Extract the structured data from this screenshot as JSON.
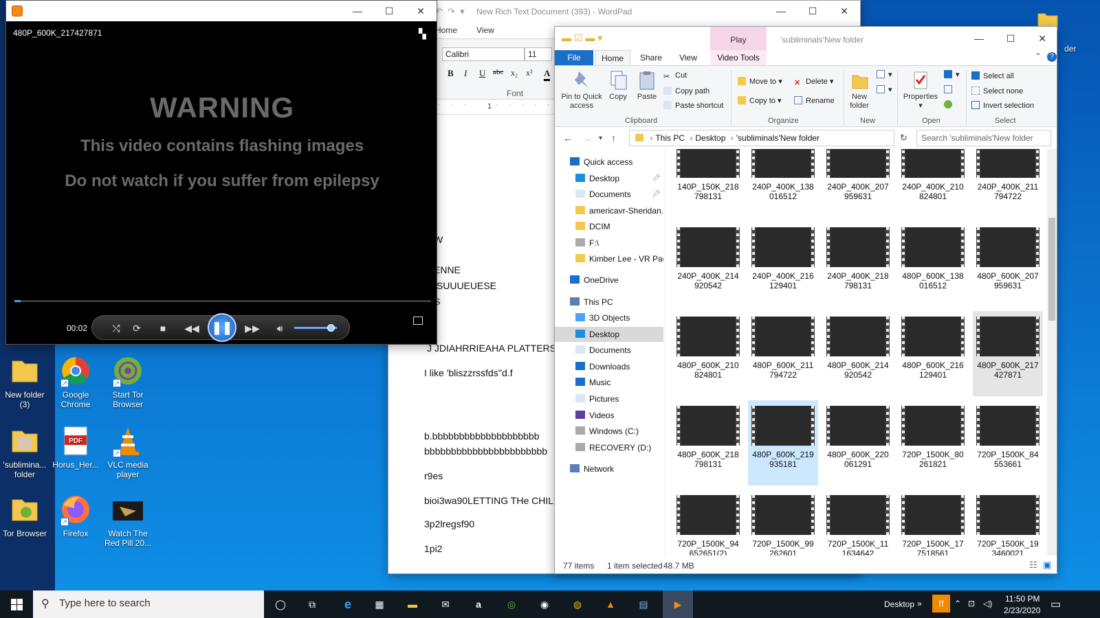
{
  "desktop": {
    "icons": [
      {
        "label": "New folder (3)"
      },
      {
        "label": "Google Chrome"
      },
      {
        "label": "Start Tor Browser"
      },
      {
        "label": "'sublimina... folder"
      },
      {
        "label": "Horus_Her..."
      },
      {
        "label": "VLC media player"
      },
      {
        "label": "Tor Browser"
      },
      {
        "label": "Firefox"
      },
      {
        "label": "Watch The Red Pill 20..."
      }
    ],
    "partial_label": "der"
  },
  "media_player": {
    "video_title": "480P_600K_217427871",
    "warning_heading": "WARNING",
    "warning_line1": "This video contains flashing images",
    "warning_line2": "Do not watch if you suffer from epilepsy",
    "time": "00:02",
    "progress_fraction": 0.015,
    "volume_fraction": 0.85
  },
  "wordpad": {
    "title": "New Rich Text Document (393) - WordPad",
    "tabs": [
      "Home",
      "View"
    ],
    "font_name": "Calibri",
    "font_size": "11",
    "font_group_label": "Font",
    "ruler_mark": "1",
    "doc_lines": [
      "I",
      "W",
      "ENNE",
      "ISUUUEUESE",
      "S",
      "J JDIAHRRIEAHA PLATTERS.",
      "I like 'bliszzrssfds''d.f",
      "b.bbbbbbbbbbbbbbbbbbbb",
      "bbbbbbbbbbbbbbbbbbbbbbb",
      "r9es",
      "bioi3wa90LETTING THe CHIL",
      "3p2lregsf90",
      "1pi2"
    ]
  },
  "explorer": {
    "title": "'subliminals'New folder",
    "contextual_tab": "Play",
    "tabs": {
      "file": "File",
      "home": "Home",
      "share": "Share",
      "view": "View",
      "video_tools": "Video Tools"
    },
    "ribbon": {
      "pin": "Pin to Quick access",
      "copy": "Copy",
      "paste": "Paste",
      "cut": "Cut",
      "copy_path": "Copy path",
      "paste_shortcut": "Paste shortcut",
      "clipboard_label": "Clipboard",
      "move_to": "Move to",
      "copy_to": "Copy to",
      "delete": "Delete",
      "rename": "Rename",
      "organize_label": "Organize",
      "new_folder": "New folder",
      "new_label": "New",
      "properties": "Properties",
      "open_label": "Open",
      "select_all": "Select all",
      "select_none": "Select none",
      "invert_selection": "Invert selection",
      "select_label": "Select"
    },
    "address": [
      "This PC",
      "Desktop",
      "'subliminals'New folder"
    ],
    "search_placeholder": "Search 'subliminals'New folder",
    "nav": [
      {
        "label": "Quick access",
        "level": 0
      },
      {
        "label": "Desktop",
        "level": 1,
        "pinned": true
      },
      {
        "label": "Documents",
        "level": 1,
        "pinned": true
      },
      {
        "label": "americavr-Sheridan.",
        "level": 1
      },
      {
        "label": "DCIM",
        "level": 1
      },
      {
        "label": "F:\\",
        "level": 1
      },
      {
        "label": "Kimber Lee - VR Pac",
        "level": 1
      },
      {
        "label": "OneDrive",
        "level": 0
      },
      {
        "label": "This PC",
        "level": 0
      },
      {
        "label": "3D Objects",
        "level": 1
      },
      {
        "label": "Desktop",
        "level": 1,
        "selected": true
      },
      {
        "label": "Documents",
        "level": 1
      },
      {
        "label": "Downloads",
        "level": 1
      },
      {
        "label": "Music",
        "level": 1
      },
      {
        "label": "Pictures",
        "level": 1
      },
      {
        "label": "Videos",
        "level": 1
      },
      {
        "label": "Windows (C:)",
        "level": 1
      },
      {
        "label": "RECOVERY (D:)",
        "level": 1
      },
      {
        "label": "Network",
        "level": 0
      }
    ],
    "files": [
      {
        "name": "140P_150K_218798131"
      },
      {
        "name": "240P_400K_138016512"
      },
      {
        "name": "240P_400K_207959631"
      },
      {
        "name": "240P_400K_210824801"
      },
      {
        "name": "240P_400K_211794722"
      },
      {
        "name": "240P_400K_214920542"
      },
      {
        "name": "240P_400K_216129401"
      },
      {
        "name": "240P_400K_218798131"
      },
      {
        "name": "480P_600K_138016512"
      },
      {
        "name": "480P_600K_207959631"
      },
      {
        "name": "480P_600K_210824801"
      },
      {
        "name": "480P_600K_211794722"
      },
      {
        "name": "480P_600K_214920542"
      },
      {
        "name": "480P_600K_216129401"
      },
      {
        "name": "480P_600K_217427871",
        "state": "hover"
      },
      {
        "name": "480P_600K_218798131"
      },
      {
        "name": "480P_600K_219935181",
        "state": "selected"
      },
      {
        "name": "480P_600K_220061291"
      },
      {
        "name": "720P_1500K_80261821"
      },
      {
        "name": "720P_1500K_84553661"
      },
      {
        "name": "720P_1500K_94652651(2)"
      },
      {
        "name": "720P_1500K_99262601"
      },
      {
        "name": "720P_1500K_111634642"
      },
      {
        "name": "720P_1500K_177518561"
      },
      {
        "name": "720P_1500K_193460021"
      }
    ],
    "status": {
      "items": "77 items",
      "selected": "1 item selected",
      "size": "48.7 MB"
    }
  },
  "taskbar": {
    "search_placeholder": "Type here to search",
    "desktop_label": "Desktop",
    "time": "11:50 PM",
    "date": "2/23/2020"
  }
}
